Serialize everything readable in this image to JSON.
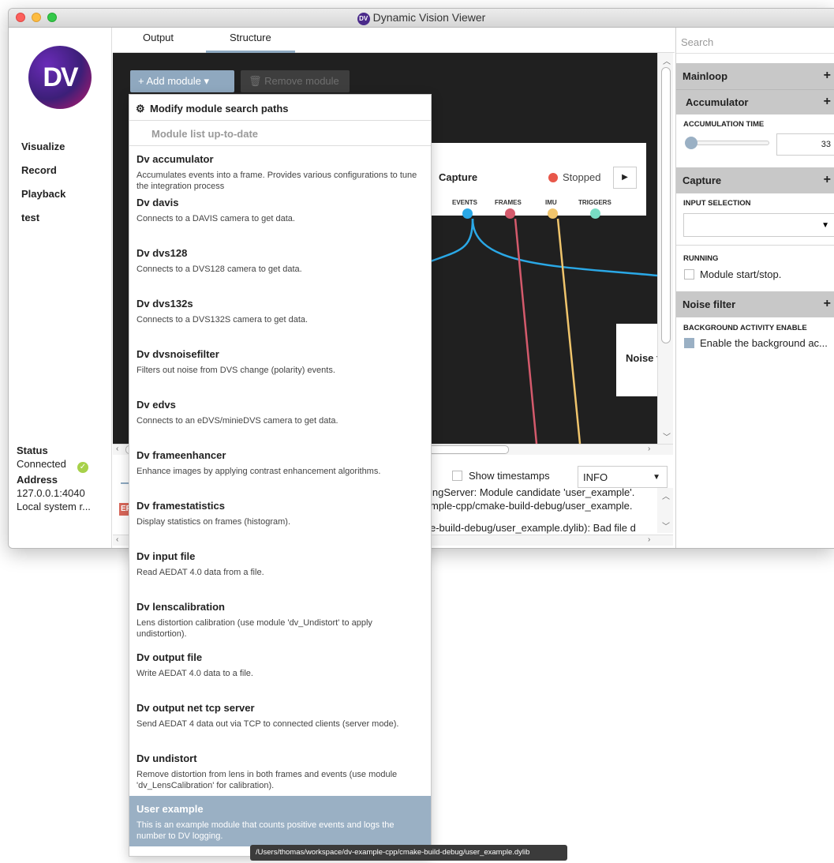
{
  "window": {
    "title": "Dynamic Vision Viewer",
    "badge": "DV"
  },
  "sidebar": {
    "logo_text": "DV",
    "nav": [
      "Visualize",
      "Record",
      "Playback",
      "test"
    ],
    "status_label": "Status",
    "status_value": "Connected",
    "address_label": "Address",
    "address_value": "127.0.0.1:4040",
    "local_value": "Local system r..."
  },
  "tabs": [
    "Output",
    "Structure"
  ],
  "toolbar": {
    "add_module": "+ Add module ▾",
    "remove_module": "🗑 Remove module"
  },
  "capture_node": {
    "title": "Capture",
    "state": "Stopped",
    "outputs": [
      "EVENTS",
      "FRAMES",
      "IMU",
      "TRIGGERS"
    ],
    "output_colors": [
      "#2aa8e6",
      "#d45a6c",
      "#f0c56c",
      "#78dcc4"
    ]
  },
  "noise_node": {
    "title": "Noise fil"
  },
  "dropdown": {
    "modify_paths": "Modify module search paths",
    "status": "Module list up-to-date",
    "items": [
      {
        "name": "Dv accumulator",
        "desc": "Accumulates events into a frame. Provides various configurations to tune the integration process"
      },
      {
        "name": "Dv davis",
        "desc": "Connects to a DAVIS camera to get data."
      },
      {
        "name": "Dv dvs128",
        "desc": "Connects to a DVS128 camera to get data."
      },
      {
        "name": "Dv dvs132s",
        "desc": "Connects to a DVS132S camera to get data."
      },
      {
        "name": "Dv dvsnoisefilter",
        "desc": "Filters out noise from DVS change (polarity) events."
      },
      {
        "name": "Dv edvs",
        "desc": "Connects to an eDVS/minieDVS camera to get data."
      },
      {
        "name": "Dv frameenhancer",
        "desc": "Enhance images by applying contrast enhancement algorithms."
      },
      {
        "name": "Dv framestatistics",
        "desc": "Display statistics on frames (histogram)."
      },
      {
        "name": "Dv input file",
        "desc": "Read AEDAT 4.0 data from a file."
      },
      {
        "name": "Dv lenscalibration",
        "desc": "Lens distortion calibration (use module 'dv_Undistort' to apply undistortion)."
      },
      {
        "name": "Dv output file",
        "desc": "Write AEDAT 4.0 data to a file."
      },
      {
        "name": "Dv output net tcp server",
        "desc": "Send AEDAT 4 data out via TCP to connected clients (server mode)."
      },
      {
        "name": "Dv undistort",
        "desc": "Remove distortion from lens in both frames and events (use module 'dv_LensCalibration' for calibration)."
      },
      {
        "name": "User example",
        "desc": "This is an example module that counts positive events and logs the number to DV logging."
      }
    ]
  },
  "tooltip": "/Users/thomas/workspace/dv-example-cpp/cmake-build-debug/user_example.dylib",
  "log": {
    "show_timestamps": "Show timestamps",
    "level": "INFO",
    "error_tag": "EF",
    "lines": [
      "ingServer: Module candidate 'user_example'.",
      "mple-cpp/cmake-build-debug/user_example.",
      "",
      "e-build-debug/user_example.dylib): Bad file d"
    ]
  },
  "right_panel": {
    "search_placeholder": "Search",
    "mainloop": "Mainloop",
    "accumulator": "Accumulator",
    "accumulation_time_label": "ACCUMULATION TIME",
    "accumulation_time_value": "33",
    "capture": "Capture",
    "input_selection_label": "INPUT SELECTION",
    "running_label": "RUNNING",
    "running_checkbox": "Module start/stop.",
    "noise_filter": "Noise filter",
    "bg_activity_label": "BACKGROUND ACTIVITY ENABLE",
    "bg_activity_checkbox": "Enable the background ac..."
  }
}
